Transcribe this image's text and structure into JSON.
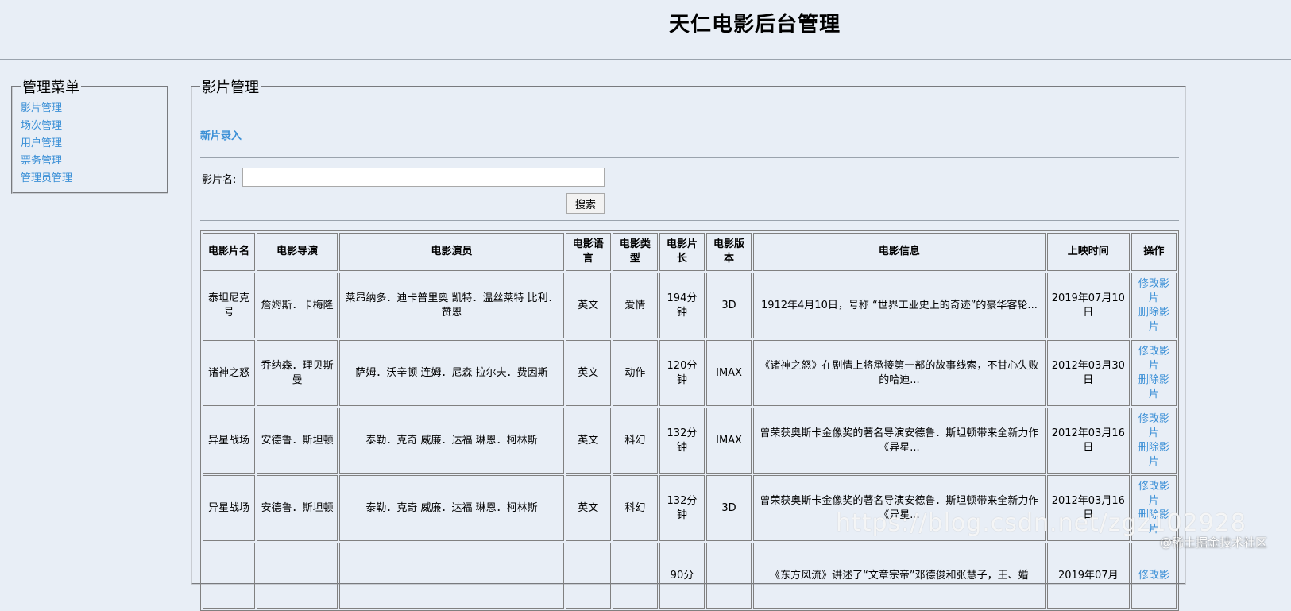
{
  "header": {
    "title": "天仁电影后台管理"
  },
  "sidebar": {
    "legend": "管理菜单",
    "items": [
      {
        "label": "影片管理"
      },
      {
        "label": "场次管理"
      },
      {
        "label": "用户管理"
      },
      {
        "label": "票务管理"
      },
      {
        "label": "管理员管理"
      }
    ]
  },
  "main": {
    "legend": "影片管理",
    "new_link": "新片录入",
    "search": {
      "label": "影片名:",
      "value": "",
      "button": "搜索"
    },
    "table": {
      "headers": [
        "电影片名",
        "电影导演",
        "电影演员",
        "电影语言",
        "电影类型",
        "电影片长",
        "电影版本",
        "电影信息",
        "上映时间",
        "操作"
      ],
      "rows": [
        {
          "name": "泰坦尼克号",
          "director": "詹姆斯．卡梅隆",
          "actors": "莱昂纳多．迪卡普里奥 凯特．温丝莱特 比利．赞恩",
          "language": "英文",
          "genre": "爱情",
          "duration": "194分钟",
          "version": "3D",
          "info": "1912年4月10日，号称 “世界工业史上的奇迹”的豪华客轮...",
          "date": "2019年07月10日",
          "edit": "修改影片",
          "delete": "删除影片"
        },
        {
          "name": "诸神之怒",
          "director": "乔纳森．理贝斯曼",
          "actors": "萨姆．沃辛顿 连姆．尼森 拉尔夫．费因斯",
          "language": "英文",
          "genre": "动作",
          "duration": "120分钟",
          "version": "IMAX",
          "info": "《诸神之怒》在剧情上将承接第一部的故事线索，不甘心失败的哈迪...",
          "date": "2012年03月30日",
          "edit": "修改影片",
          "delete": "删除影片"
        },
        {
          "name": "异星战场",
          "director": "安德鲁．斯坦顿",
          "actors": "泰勒．克奇 威廉．达福 琳恩．柯林斯",
          "language": "英文",
          "genre": "科幻",
          "duration": "132分钟",
          "version": "IMAX",
          "info": "曾荣获奥斯卡金像奖的著名导演安德鲁．斯坦顿带来全新力作《异星...",
          "date": "2012年03月16日",
          "edit": "修改影片",
          "delete": "删除影片"
        },
        {
          "name": "异星战场",
          "director": "安德鲁．斯坦顿",
          "actors": "泰勒．克奇 威廉．达福 琳恩．柯林斯",
          "language": "英文",
          "genre": "科幻",
          "duration": "132分钟",
          "version": "3D",
          "info": "曾荣获奥斯卡金像奖的著名导演安德鲁．斯坦顿带来全新力作《异星...",
          "date": "2012年03月16日",
          "edit": "修改影片",
          "delete": "删除影片"
        },
        {
          "name": "",
          "director": "",
          "actors": "",
          "language": "",
          "genre": "",
          "duration": "90分",
          "version": "",
          "info": "《东方风流》讲述了“文章宗帝”邓德俊和张慧子，王、婚",
          "date": "2019年07月",
          "edit": "修改影",
          "delete": ""
        }
      ]
    }
  },
  "watermark": {
    "url": "https://blog.csdn.net/zgz102928",
    "site": "@稀土掘金技术社区"
  }
}
